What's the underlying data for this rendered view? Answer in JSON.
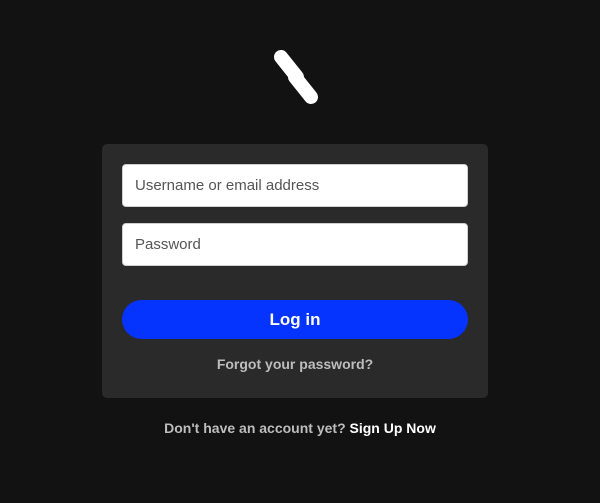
{
  "logo": {
    "icon": "brand-s-logo-icon",
    "color": "#ffffff"
  },
  "form": {
    "username_placeholder": "Username or email address",
    "username_value": "",
    "password_placeholder": "Password",
    "password_value": "",
    "login_label": "Log in",
    "forgot_label": "Forgot your password?"
  },
  "signup": {
    "prompt": "Don't have an account yet?",
    "link_label": "Sign Up Now"
  },
  "colors": {
    "background": "#121212",
    "card": "#2a2a2a",
    "accent": "#0533ff",
    "muted_text": "#bdbdbd"
  }
}
